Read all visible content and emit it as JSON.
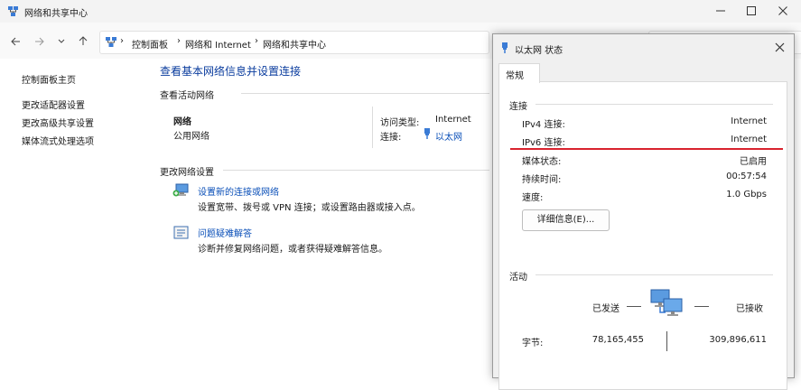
{
  "window": {
    "title": "网络和共享中心"
  },
  "nav": {
    "breadcrumb": [
      "控制面板",
      "网络和 Internet",
      "网络和共享中心"
    ]
  },
  "sidebar": {
    "items": [
      {
        "label": "控制面板主页"
      },
      {
        "label": "更改适配器设置"
      },
      {
        "label": "更改高级共享设置"
      },
      {
        "label": "媒体流式处理选项"
      }
    ]
  },
  "main": {
    "heading": "查看基本网络信息并设置连接",
    "active_section": "查看活动网络",
    "network_name": "网络",
    "network_type": "公用网络",
    "access_type_label": "访问类型:",
    "access_type_value": "Internet",
    "connection_label": "连接:",
    "connection_value": "以太网",
    "change_section": "更改网络设置",
    "tasks": [
      {
        "title": "设置新的连接或网络",
        "desc": "设置宽带、拨号或 VPN 连接；或设置路由器或接入点。"
      },
      {
        "title": "问题疑难解答",
        "desc": "诊断并修复网络问题，或者获得疑难解答信息。"
      }
    ]
  },
  "dialog": {
    "title": "以太网 状态",
    "tab": "常规",
    "connection_group": "连接",
    "rows": [
      {
        "label": "IPv4 连接:",
        "value": "Internet"
      },
      {
        "label": "IPv6 连接:",
        "value": "Internet"
      },
      {
        "label": "媒体状态:",
        "value": "已启用"
      },
      {
        "label": "持续时间:",
        "value": "00:57:54"
      },
      {
        "label": "速度:",
        "value": "1.0 Gbps"
      }
    ],
    "details_button": "详细信息(E)...",
    "activity_group": "活动",
    "sent_label": "已发送",
    "received_label": "已接收",
    "bytes_label": "字节:",
    "bytes_sent": "78,165,455",
    "bytes_received": "309,896,611",
    "highlight_color": "#d9232e"
  }
}
